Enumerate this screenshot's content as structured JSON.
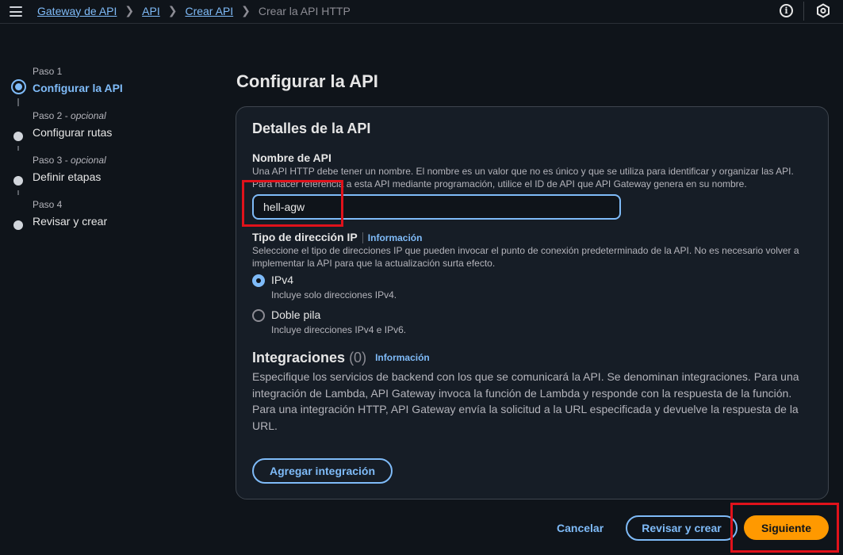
{
  "breadcrumb": {
    "items": [
      "Gateway de API",
      "API",
      "Crear API"
    ],
    "current": "Crear la API HTTP"
  },
  "icons": {
    "menu": "hamburger-menu-icon",
    "info": "info-circle-icon",
    "settings": "hexagon-settings-icon"
  },
  "steps": [
    {
      "num": "Paso 1",
      "optional": "",
      "title": "Configurar la API",
      "active": true
    },
    {
      "num": "Paso 2 - ",
      "optional": "opcional",
      "title": "Configurar rutas",
      "active": false
    },
    {
      "num": "Paso 3 - ",
      "optional": "opcional",
      "title": "Definir etapas",
      "active": false
    },
    {
      "num": "Paso 4",
      "optional": "",
      "title": "Revisar y crear",
      "active": false
    }
  ],
  "page_title": "Configurar la API",
  "details": {
    "title": "Detalles de la API",
    "name_label": "Nombre de API",
    "name_desc": "Una API HTTP debe tener un nombre. El nombre es un valor que no es único y que se utiliza para identificar y organizar las API. Para hacer referencia a esta API mediante programación, utilice el ID de API que API Gateway genera en su nombre.",
    "name_value": "hell-agw",
    "ip_label": "Tipo de dirección IP",
    "info_link": "Información",
    "ip_desc": "Seleccione el tipo de direcciones IP que pueden invocar el punto de conexión predeterminado de la API. No es necesario volver a implementar la API para que la actualización surta efecto.",
    "options": [
      {
        "label": "IPv4",
        "desc": "Incluye solo direcciones IPv4.",
        "checked": true
      },
      {
        "label": "Doble pila",
        "desc": "Incluye direcciones IPv4 e IPv6.",
        "checked": false
      }
    ],
    "integrations_title": "Integraciones",
    "integrations_count": "(0)",
    "integrations_desc": "Especifique los servicios de backend con los que se comunicará la API. Se denominan integraciones. Para una integración de Lambda, API Gateway invoca la función de Lambda y responde con la respuesta de la función. Para una integración HTTP, API Gateway envía la solicitud a la URL especificada y devuelve la respuesta de la URL.",
    "add_integration": "Agregar integración"
  },
  "footer": {
    "cancel": "Cancelar",
    "review": "Revisar y crear",
    "next": "Siguiente"
  },
  "colors": {
    "accent": "#7fbbf8",
    "primary": "#ff9900",
    "highlight": "#e0121b",
    "background": "#0f141a"
  }
}
